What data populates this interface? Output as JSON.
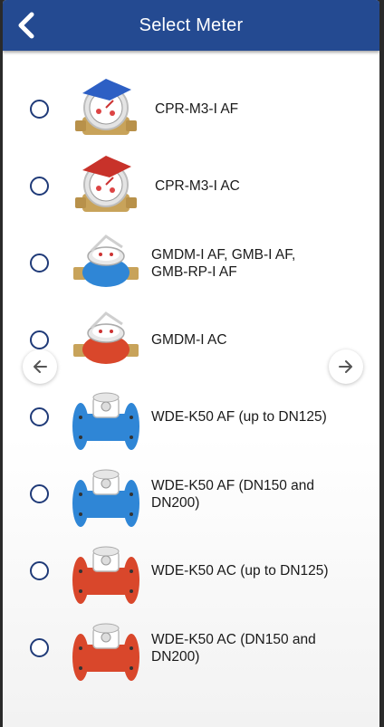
{
  "header": {
    "title": "Select Meter",
    "back_icon": "chevron-left-icon"
  },
  "colors": {
    "header_bg": "#244a91",
    "radio_border": "#1f3a78",
    "blue_meter": "#2f86d6",
    "red_meter": "#d9472b",
    "brass": "#c8a35a"
  },
  "meters": [
    {
      "label": "CPR-M3-I AF",
      "image": "cpr-meter-blue-lid-icon",
      "selected": false
    },
    {
      "label": "CPR-M3-I AC",
      "image": "cpr-meter-red-lid-icon",
      "selected": false
    },
    {
      "label": "GMDM-I AF, GMB-I AF,\nGMB-RP-I AF",
      "image": "gmdm-meter-blue-icon",
      "selected": false
    },
    {
      "label": "GMDM-I AC",
      "image": "gmdm-meter-red-icon",
      "selected": false
    },
    {
      "label": "WDE-K50 AF (up to DN125)",
      "image": "wde-meter-blue-icon",
      "selected": false
    },
    {
      "label": "WDE-K50 AF (DN150 and\nDN200)",
      "image": "wde-meter-blue-icon",
      "selected": false
    },
    {
      "label": "WDE-K50 AC (up to DN125)",
      "image": "wde-meter-red-icon",
      "selected": false
    },
    {
      "label": "WDE-K50 AC (DN150 and\nDN200)",
      "image": "wde-meter-red-icon",
      "selected": false
    }
  ],
  "carousel": {
    "prev_icon": "arrow-left-icon",
    "next_icon": "arrow-right-icon"
  }
}
